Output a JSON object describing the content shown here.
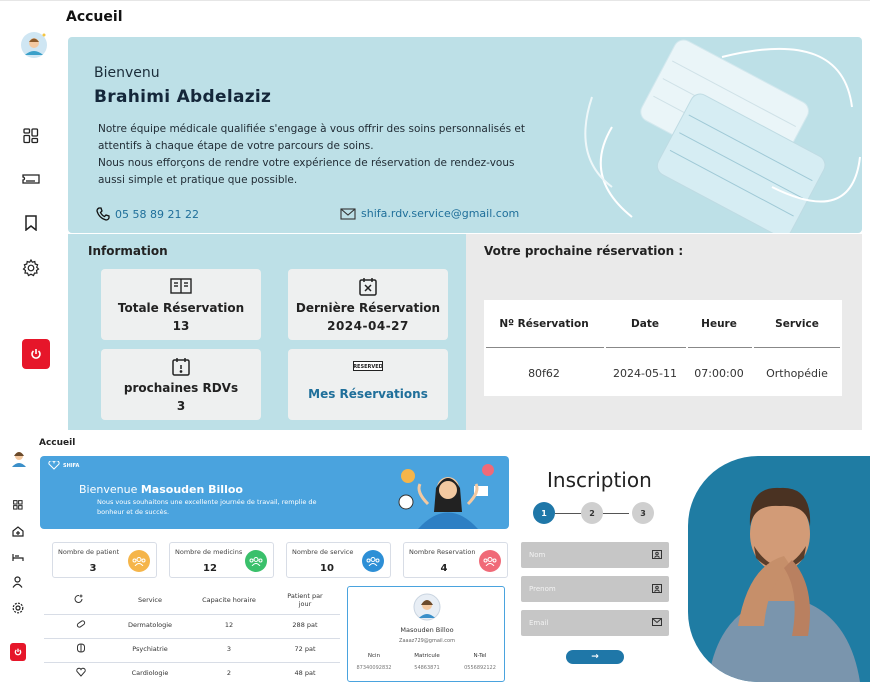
{
  "top": {
    "page_title": "Accueil",
    "welcome": "Bienvenu",
    "user_name": "Brahimi Abdelaziz",
    "intro_line1": "Notre équipe médicale qualifiée s'engage à vous offrir des soins personnalisés et attentifs à chaque étape de votre parcours de soins.",
    "intro_line2": "Nous nous efforçons de rendre votre expérience de réservation de rendez-vous aussi simple et pratique que possible.",
    "phone": "05 58 89 21 22",
    "email": "shifa.rdv.service@gmail.com",
    "info_title": "Information",
    "cards": [
      {
        "label": "Totale Réservation",
        "value": "13",
        "icon": "book-icon"
      },
      {
        "label": "Dernière Réservation",
        "value": "2024-04-27",
        "icon": "calendar-x-icon"
      },
      {
        "label": "prochaines RDVs",
        "value": "3",
        "icon": "calendar-alert-icon"
      },
      {
        "label": "Mes Réservations",
        "icon": "reserved-sign-icon"
      }
    ],
    "reserved_sign": "RESERVED",
    "next_title": "Votre prochaine réservation :",
    "table_headers": [
      "Nº Réservation",
      "Date",
      "Heure",
      "Service"
    ],
    "table_row": [
      "80f62",
      "2024-05-11",
      "07:00:00",
      "Orthopédie"
    ],
    "sidebar_icons": [
      "avatar",
      "dashboard-icon",
      "ticket-icon",
      "bookmark-icon",
      "gear-icon",
      "power-icon"
    ]
  },
  "bottom_left": {
    "page_title": "Accueil",
    "banner_logo": "SHIFA",
    "welcome_prefix": "Bienvenue",
    "user_name": "Masouden Billoo",
    "message": "Nous vous souhaitons une excellente journée de travail, remplie de bonheur et de succès.",
    "stats": [
      {
        "label": "Nombre de patient",
        "value": "3",
        "color": "#f5b54a"
      },
      {
        "label": "Nombre de medicins",
        "value": "12",
        "color": "#3ac06b"
      },
      {
        "label": "Nombre de service",
        "value": "10",
        "color": "#2d8fd6"
      },
      {
        "label": "Nombre Reservation",
        "value": "4",
        "color": "#f06a78"
      }
    ],
    "table_headers": [
      "Service",
      "Capacite horaire",
      "Patient par jour"
    ],
    "rows": [
      {
        "service": "Dermatologie",
        "capacity": "12",
        "per_day": "288 pat"
      },
      {
        "service": "Psychiatrie",
        "capacity": "3",
        "per_day": "72 pat"
      },
      {
        "service": "Cardiologie",
        "capacity": "2",
        "per_day": "48 pat"
      }
    ],
    "user_card": {
      "name": "Masouden Billoo",
      "email": "Zaaaz729@gmail.com",
      "labels": [
        "Ncin",
        "Matricule",
        "N-Tel"
      ],
      "values": [
        "87340092832",
        "54863871",
        "0556892122"
      ]
    }
  },
  "bottom_right": {
    "title": "Inscription",
    "steps": [
      "1",
      "2",
      "3"
    ],
    "nom_placeholder": "Nom",
    "prenom_placeholder": "Prenom",
    "email_placeholder": "Email",
    "submit_arrow": "→"
  },
  "colors": {
    "accent_teal": "#bde0e7",
    "danger": "#e6162a",
    "step_active": "#1f77a8",
    "blue": "#4aa3de"
  }
}
